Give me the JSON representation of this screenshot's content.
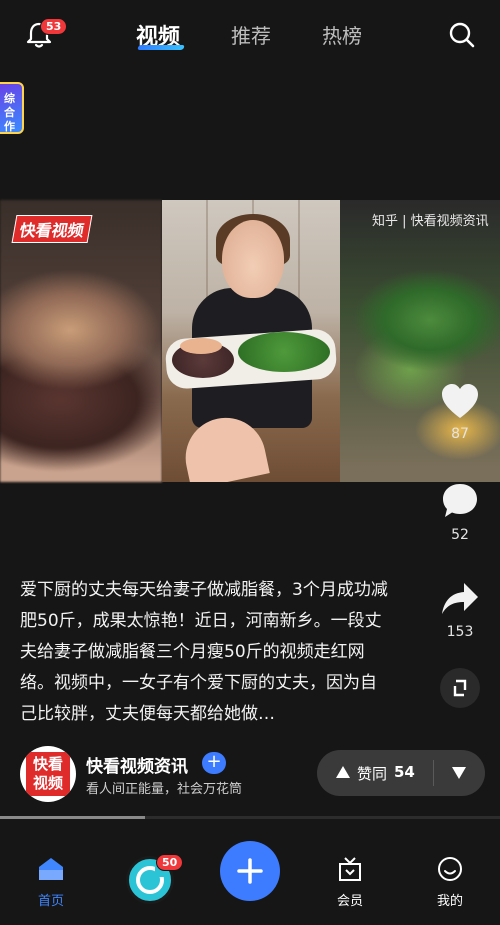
{
  "header": {
    "notification_count": "53",
    "tabs": [
      {
        "label": "视频",
        "active": true
      },
      {
        "label": "推荐",
        "active": false
      },
      {
        "label": "热榜",
        "active": false
      }
    ]
  },
  "side_badge": {
    "text": "综合作"
  },
  "video": {
    "left_logo": "快看视频",
    "watermark": "知乎 | 快看视频资讯"
  },
  "actions": {
    "likes": "87",
    "comments": "52",
    "shares": "153"
  },
  "post": {
    "description": "爱下厨的丈夫每天给妻子做减脂餐，3个月成功减肥50斤，成果太惊艳！近日，河南新乡。一段丈夫给妻子做减脂餐三个月瘦50斤的视频走红网络。视频中，一女子有个爱下厨的丈夫，因为自己比较胖，丈夫便每天都给她做…",
    "progress": 0.29
  },
  "author": {
    "avatar_text": "快看视频",
    "name": "快看视频资讯",
    "follow_label": "+",
    "tagline": "看人间正能量，社会万花筒"
  },
  "agree": {
    "label": "赞同",
    "count": "54"
  },
  "nav": {
    "home": "首页",
    "live_badge": "50",
    "member": "会员",
    "me": "我的"
  },
  "colors": {
    "accent": "#3d7bff",
    "badge": "#f0383b",
    "background": "#161616"
  }
}
